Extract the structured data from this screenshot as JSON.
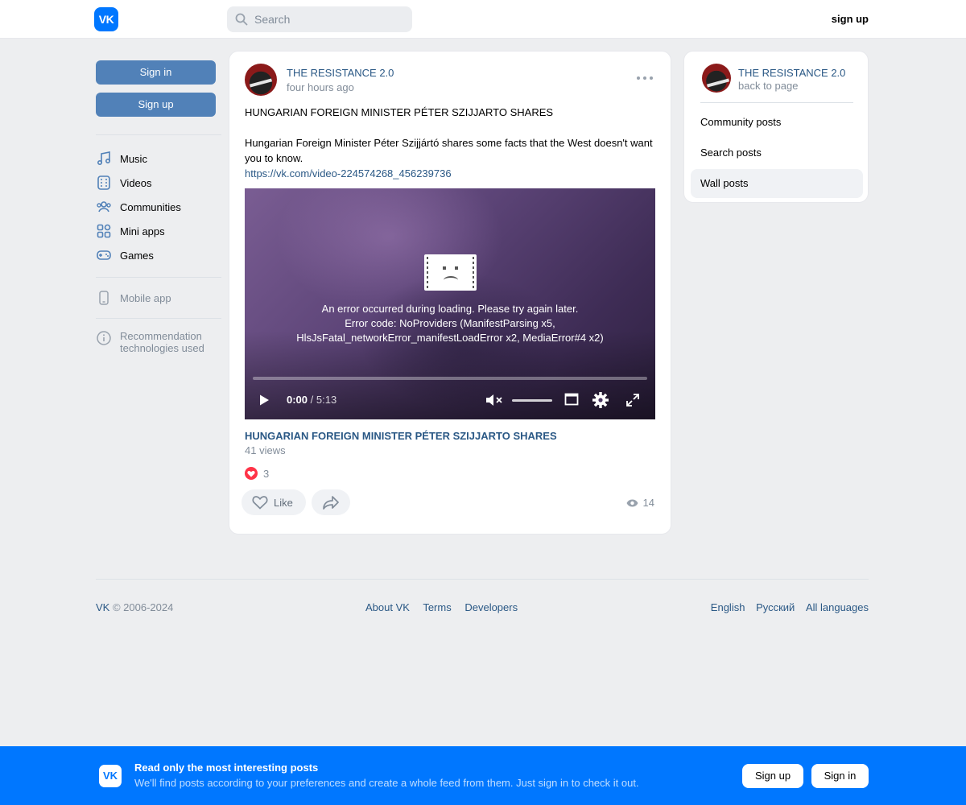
{
  "header": {
    "logo": "VK",
    "search_placeholder": "Search",
    "signup_label": "sign up"
  },
  "sidebar": {
    "sign_in_label": "Sign in",
    "sign_up_label": "Sign up",
    "nav": [
      {
        "label": "Music",
        "icon": "music-icon"
      },
      {
        "label": "Videos",
        "icon": "videos-icon"
      },
      {
        "label": "Communities",
        "icon": "communities-icon"
      },
      {
        "label": "Mini apps",
        "icon": "mini-apps-icon"
      },
      {
        "label": "Games",
        "icon": "games-icon"
      }
    ],
    "mobile_app": "Mobile app",
    "recommendation_line1": "Recommendation",
    "recommendation_line2": "technologies used"
  },
  "post": {
    "author": "THE RESISTANCE 2.0",
    "time": "four hours ago",
    "text_title": "HUNGARIAN FOREIGN MINISTER PÉTER SZIJJARTO SHARES",
    "text_body": "Hungarian Foreign Minister Péter Szijjártó shares some facts that the West doesn't want you to know.",
    "link": "https://vk.com/video-224574268_456239736",
    "video": {
      "error_line1": "An error occurred during loading. Please try again later.",
      "error_line2": "Error code: NoProviders (ManifestParsing x5,",
      "error_line3": "HlsJsFatal_networkError_manifestLoadError x2, MediaError#4 x2)",
      "current_time": "0:00",
      "duration": "/ 5:13",
      "progress": 0,
      "muted": true
    },
    "video_title": "HUNGARIAN FOREIGN MINISTER PÉTER SZIJJARTO SHARES",
    "video_views": "41 views",
    "reaction_count": "3",
    "like_label": "Like",
    "view_count": "14"
  },
  "right_panel": {
    "name": "THE RESISTANCE 2.0",
    "back": "back to page",
    "items": [
      "Community posts",
      "Search posts",
      "Wall posts"
    ],
    "active_item": "Wall posts"
  },
  "footer": {
    "brand": "VK",
    "copyright": "© 2006-2024",
    "links": [
      "About VK",
      "Terms",
      "Developers"
    ],
    "languages": [
      "English",
      "Русский",
      "All languages"
    ]
  },
  "banner": {
    "logo": "VK",
    "title": "Read only the most interesting posts",
    "subtitle": "We'll find posts according to your preferences and create a whole feed from them. Just sign in to check it out.",
    "sign_up": "Sign up",
    "sign_in": "Sign in"
  },
  "colors": {
    "brand": "#0077ff",
    "link": "#2a5885",
    "button": "#5181b8",
    "background": "#edeef0",
    "like": "#ff3347"
  }
}
